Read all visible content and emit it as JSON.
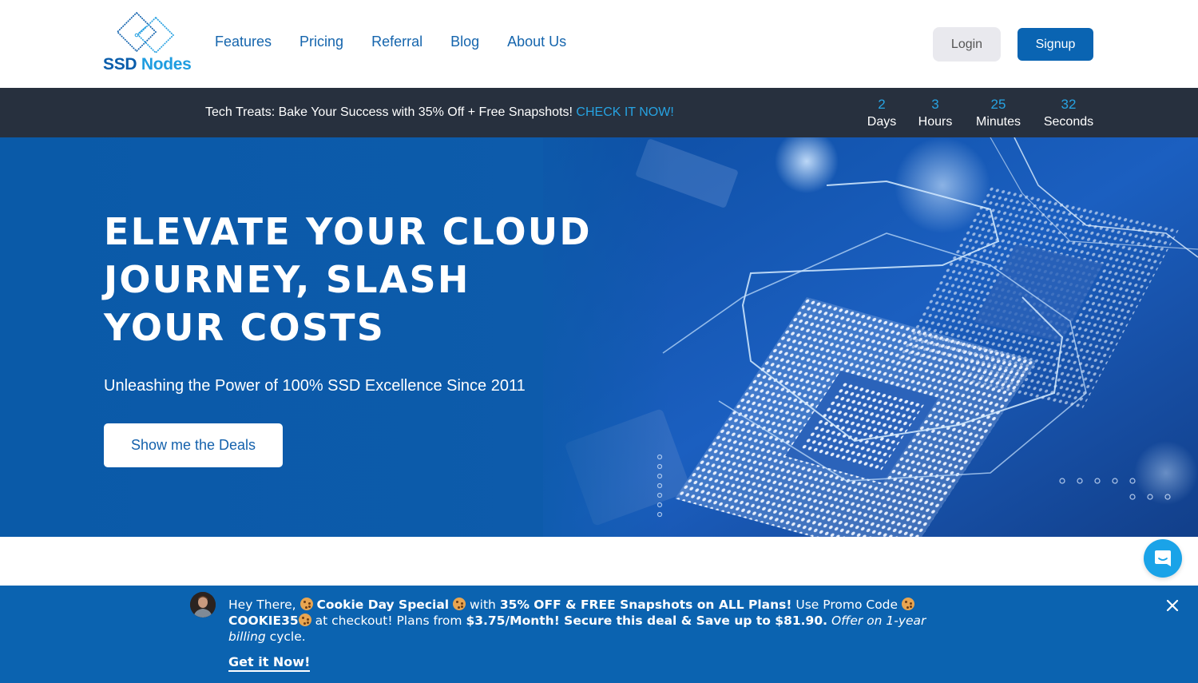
{
  "header": {
    "logo": {
      "part1": "SSD",
      "part2": "Nodes"
    },
    "nav": [
      {
        "label": "Features"
      },
      {
        "label": "Pricing"
      },
      {
        "label": "Referral"
      },
      {
        "label": "Blog"
      },
      {
        "label": "About Us"
      }
    ],
    "login_label": "Login",
    "signup_label": "Signup"
  },
  "promo_bar": {
    "text": "Tech Treats: Bake Your Success with 35% Off + Free Snapshots!",
    "link_label": "CHECK IT NOW!",
    "countdown": [
      {
        "value": "2",
        "unit": "Days"
      },
      {
        "value": "3",
        "unit": "Hours"
      },
      {
        "value": "25",
        "unit": "Minutes"
      },
      {
        "value": "32",
        "unit": "Seconds"
      }
    ]
  },
  "hero": {
    "title": "ELEVATE YOUR CLOUD JOURNEY, SLASH YOUR COSTS",
    "subtitle": "Unleashing the Power of 100% SSD Excellence Since 2011",
    "cta_label": "Show me the Deals"
  },
  "bottom_banner": {
    "greeting": "Hey There,",
    "special": "Cookie Day Special",
    "with": "with",
    "offer": "35% OFF & FREE Snapshots on ALL Plans!",
    "promo_prefix": "Use Promo Code",
    "promo_code": "COOKIE35",
    "checkout": "at checkout! Plans from",
    "price": "$3.75/Month! Secure this deal & Save up to $81.90.",
    "billing_italic": "Offer on 1-year billing",
    "billing_end": "cycle.",
    "cta_label": "Get it Now!"
  },
  "colors": {
    "brand_blue": "#0a64b2",
    "accent_cyan": "#27a3e2",
    "promo_bar_bg": "#27303e",
    "banner_bg": "#0b63b0",
    "chat_button": "#1aa3e8"
  }
}
